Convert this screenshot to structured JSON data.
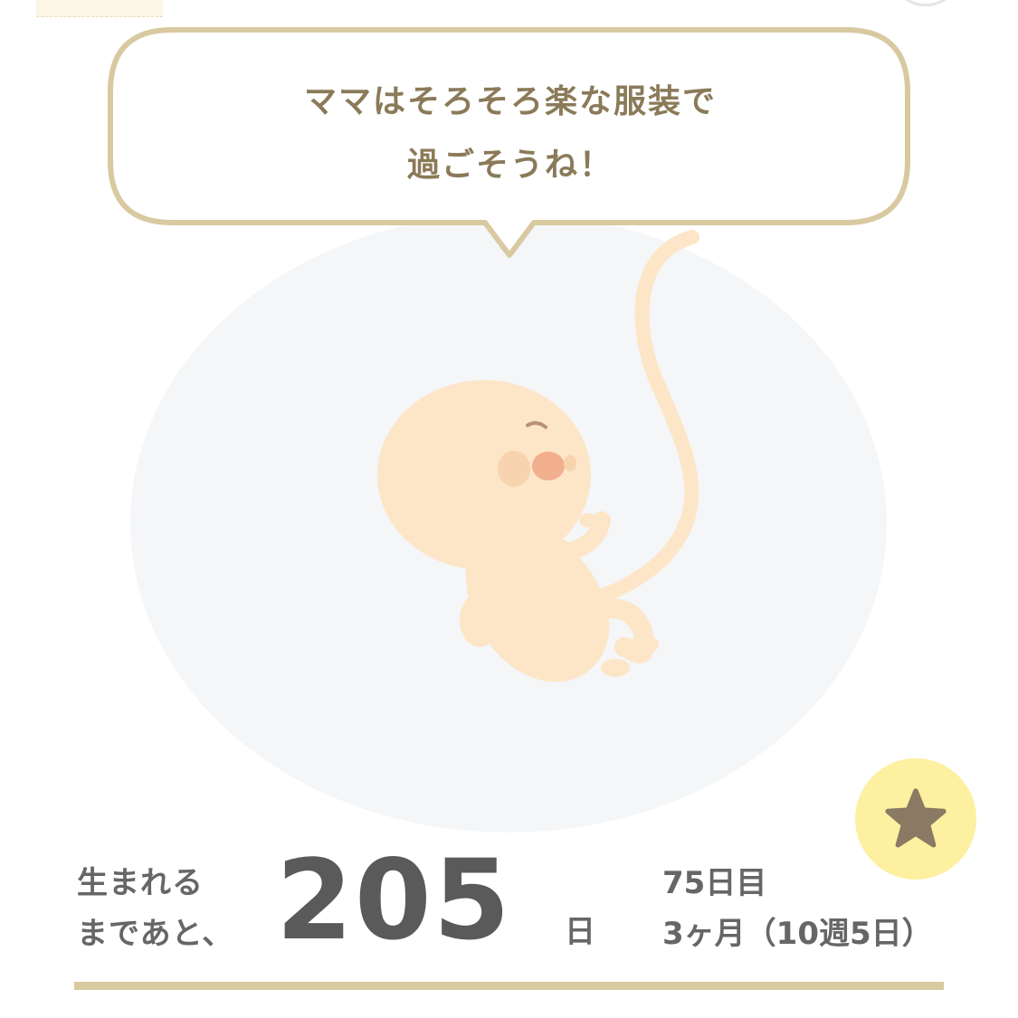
{
  "speech": {
    "line1": "ママはそろそろ楽な服装で",
    "line2": "過ごそうね！"
  },
  "favorite": {
    "icon": "star-icon",
    "color": "#8a7a63",
    "bg": "#fdf0a0"
  },
  "countdown": {
    "label_line1": "生まれる",
    "label_line2": "まであと、",
    "days": "205",
    "unit": "日"
  },
  "progress": {
    "day_count": "75日目",
    "month_week": "3ヶ月（10週5日）"
  },
  "colors": {
    "bubble_border": "#d8c9a0",
    "bubble_text": "#8a7a58",
    "womb_bg": "#f4f6f8",
    "baby_skin": "#fde6c8",
    "divider": "#d9cba0"
  }
}
